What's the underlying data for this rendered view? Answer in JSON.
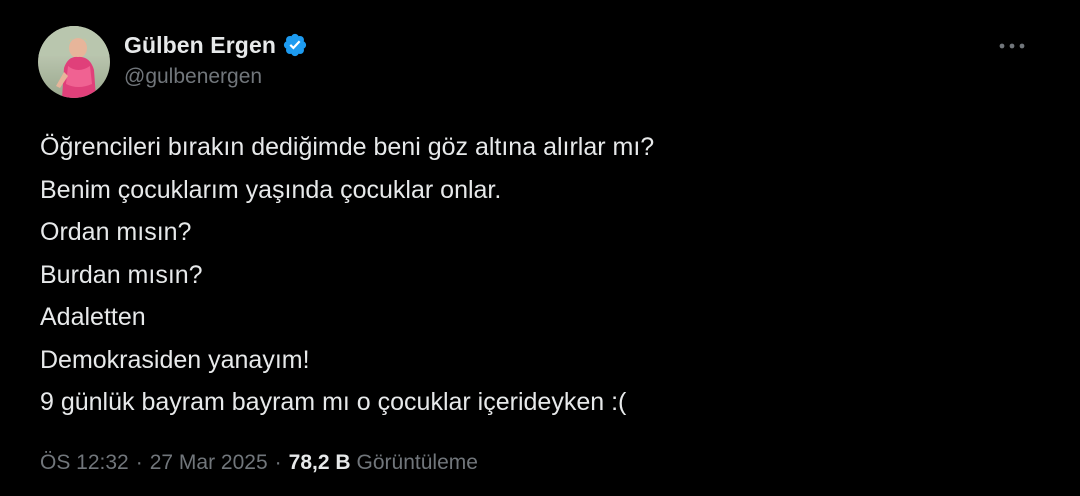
{
  "author": {
    "display_name": "Gülben Ergen",
    "handle": "@gulbenergen",
    "verified": true,
    "verified_color": "#1d9bf0",
    "avatar_icon": "profile-photo"
  },
  "more_icon": "ellipsis-icon",
  "tweet": {
    "lines": [
      "Öğrencileri bırakın dediğimde beni göz altına alırlar mı?",
      "Benim çocuklarım yaşında çocuklar onlar.",
      "Ordan mısın?",
      "Burdan mısın?",
      "Adaletten",
      "Demokrasiden yanayım!",
      "9 günlük bayram bayram mı o çocuklar içerideyken :("
    ]
  },
  "meta": {
    "time": "ÖS 12:32",
    "separator": "·",
    "date": "27 Mar 2025",
    "views_count": "78,2 B",
    "views_label": "Görüntüleme"
  },
  "colors": {
    "background": "#000000",
    "text_primary": "#e7e9ea",
    "text_secondary": "#71767b"
  }
}
